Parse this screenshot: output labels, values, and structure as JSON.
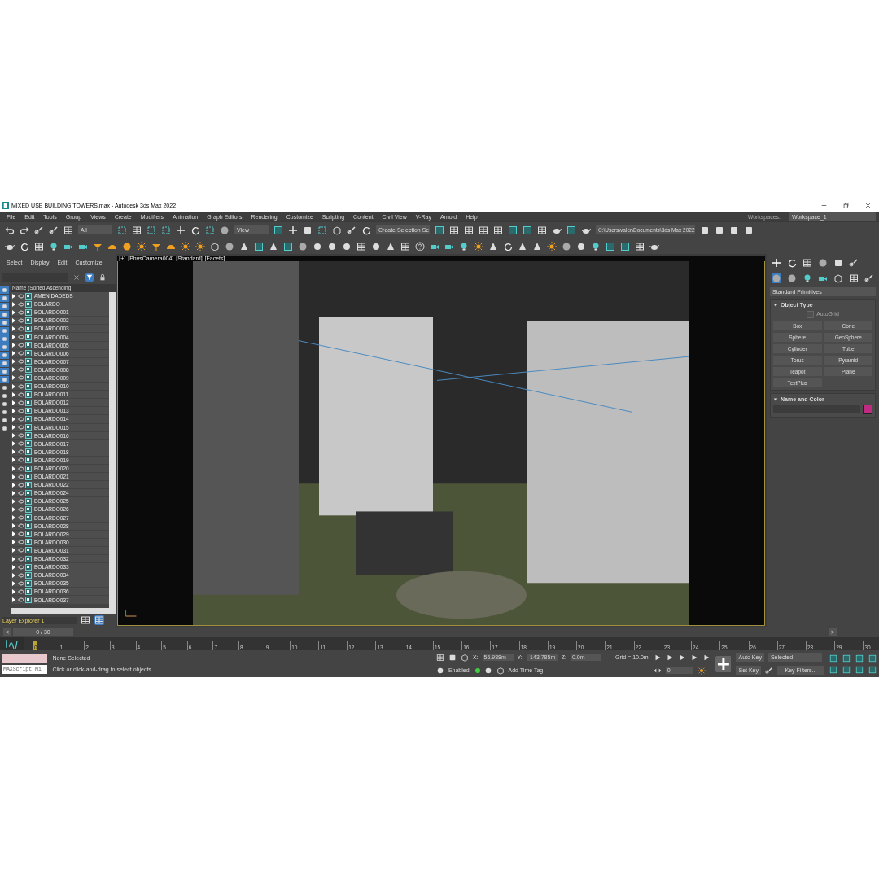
{
  "window": {
    "title": "MIXED USE BUILDING TOWERS.max - Autodesk 3ds Max 2022"
  },
  "menu": [
    "File",
    "Edit",
    "Tools",
    "Group",
    "Views",
    "Create",
    "Modifiers",
    "Animation",
    "Graph Editors",
    "Rendering",
    "Customize",
    "Scripting",
    "Content",
    "Civil View",
    "V-Ray",
    "Arnold",
    "Help"
  ],
  "toolbar": {
    "selection_filter": "All",
    "reference_coord": "View",
    "named_selection": "Create Selection Se",
    "project_path": "C:\\Users\\valer\\Documents\\3ds Max 2022"
  },
  "workspaces": {
    "label": "Workspaces:",
    "value": "Workspace_1"
  },
  "scene_explorer": {
    "menu": [
      "Select",
      "Display",
      "Edit",
      "Customize"
    ],
    "column": "Name (Sorted Ascending)",
    "rows": [
      "AMENIDADEDS",
      "BOLARDO",
      "BOLARDO001",
      "BOLARDO002",
      "BOLARDO003",
      "BOLARDO004",
      "BOLARDO005",
      "BOLARDO006",
      "BOLARDO007",
      "BOLARDO008",
      "BOLARDO009",
      "BOLARDO010",
      "BOLARDO011",
      "BOLARDO012",
      "BOLARDO013",
      "BOLARDO014",
      "BOLARDO015",
      "BOLARDO016",
      "BOLARDO017",
      "BOLARDO018",
      "BOLARDO019",
      "BOLARDO020",
      "BOLARDO021",
      "BOLARDO022",
      "BOLARDO024",
      "BOLARDO025",
      "BOLARDO026",
      "BOLARDO027",
      "BOLARDO028",
      "BOLARDO029",
      "BOLARDO030",
      "BOLARDO031",
      "BOLARDO032",
      "BOLARDO033",
      "BOLARDO034",
      "BOLARDO035",
      "BOLARDO036",
      "BOLARDO037"
    ],
    "layer": "Layer Explorer 1"
  },
  "viewport": {
    "labels": [
      "[+]",
      "[PhysCamera004]",
      "[Standard]",
      "[Facets]"
    ]
  },
  "command_panel": {
    "category": "Standard Primitives",
    "object_type": {
      "title": "Object Type",
      "autogrid": {
        "label": "AutoGrid",
        "checked": false,
        "disabled": true
      },
      "buttons": [
        "Box",
        "Cone",
        "Sphere",
        "GeoSphere",
        "Cylinder",
        "Tube",
        "Torus",
        "Pyramid",
        "Teapot",
        "Plane",
        "TextPlus"
      ]
    },
    "name_and_color": {
      "title": "Name and Color",
      "color": "#c02a80"
    }
  },
  "time_slider": {
    "prev": "<",
    "position": "0 / 30",
    "level": 0,
    "next": ">"
  },
  "track_bar": {
    "ticks": [
      "0",
      "1",
      "2",
      "3",
      "4",
      "5",
      "6",
      "7",
      "8",
      "9",
      "10",
      "11",
      "12",
      "13",
      "14",
      "15",
      "16",
      "17",
      "18",
      "19",
      "20",
      "21",
      "22",
      "23",
      "24",
      "25",
      "26",
      "27",
      "28",
      "29",
      "30"
    ]
  },
  "status": {
    "selection": "None Selected",
    "prompt": "Click or click-and-drag to select objects",
    "maxscript": "MAXScript Mi",
    "x_label": "X:",
    "x": "56.988m",
    "y_label": "Y:",
    "y": "-143.785m",
    "z_label": "Z:",
    "z": "0.0m",
    "grid": "Grid = 10.0m",
    "enabled_label": "Enabled:",
    "enabled": true,
    "time_tag": "Add Time Tag",
    "auto_key": "Auto Key",
    "key_mode": "Selected",
    "set_key": "Set Key",
    "key_filters": "Key Filters...",
    "frame": "0"
  }
}
